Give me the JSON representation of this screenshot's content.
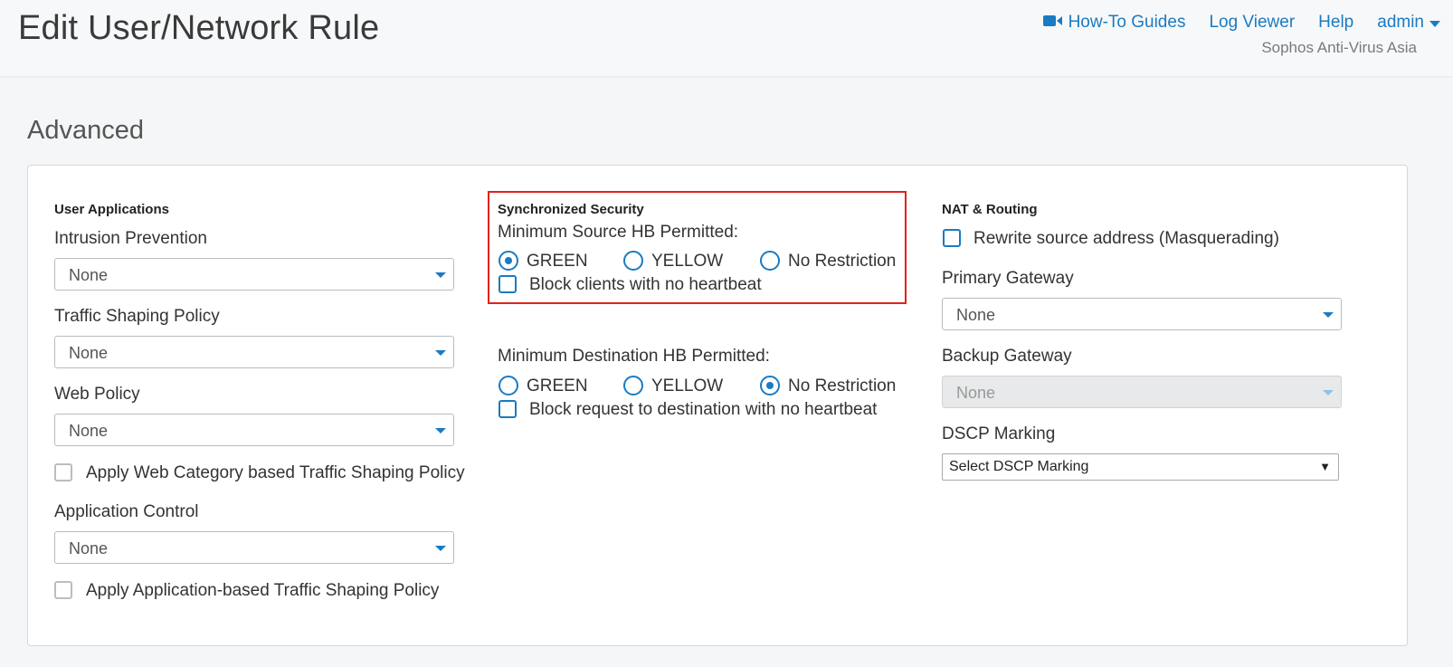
{
  "header": {
    "title": "Edit User/Network Rule",
    "nav": {
      "guides_label": "How-To Guides",
      "log_viewer_label": "Log Viewer",
      "help_label": "Help",
      "user_label": "admin"
    },
    "org_name": "Sophos Anti-Virus Asia",
    "accent_color": "#1a7bc2"
  },
  "section": {
    "title": "Advanced"
  },
  "user_apps": {
    "heading": "User Applications",
    "intrusion_prevention": {
      "label": "Intrusion Prevention",
      "value": "None"
    },
    "traffic_shaping": {
      "label": "Traffic Shaping Policy",
      "value": "None"
    },
    "web_policy": {
      "label": "Web Policy",
      "value": "None"
    },
    "web_category_shaping": {
      "label": "Apply Web Category based Traffic Shaping Policy",
      "checked": false
    },
    "app_control": {
      "label": "Application Control",
      "value": "None"
    },
    "app_shaping": {
      "label": "Apply Application-based Traffic Shaping Policy",
      "checked": false
    }
  },
  "sync_security": {
    "heading": "Synchronized Security",
    "source": {
      "label": "Minimum Source HB Permitted:",
      "options": [
        "GREEN",
        "YELLOW",
        "No Restriction"
      ],
      "selected": "GREEN",
      "block_label": "Block clients with no heartbeat"
    },
    "destination": {
      "label": "Minimum Destination HB Permitted:",
      "options": [
        "GREEN",
        "YELLOW",
        "No Restriction"
      ],
      "selected": "No Restriction",
      "block_label": "Block request to destination with no heartbeat"
    },
    "highlight_color": "#e2231a"
  },
  "nat": {
    "heading": "NAT & Routing",
    "masquerade_label": "Rewrite source address (Masquerading)",
    "primary_gateway": {
      "label": "Primary Gateway",
      "value": "None"
    },
    "backup_gateway": {
      "label": "Backup Gateway",
      "value": "None",
      "disabled": true
    },
    "dscp": {
      "label": "DSCP Marking",
      "value": "Select DSCP Marking"
    }
  }
}
